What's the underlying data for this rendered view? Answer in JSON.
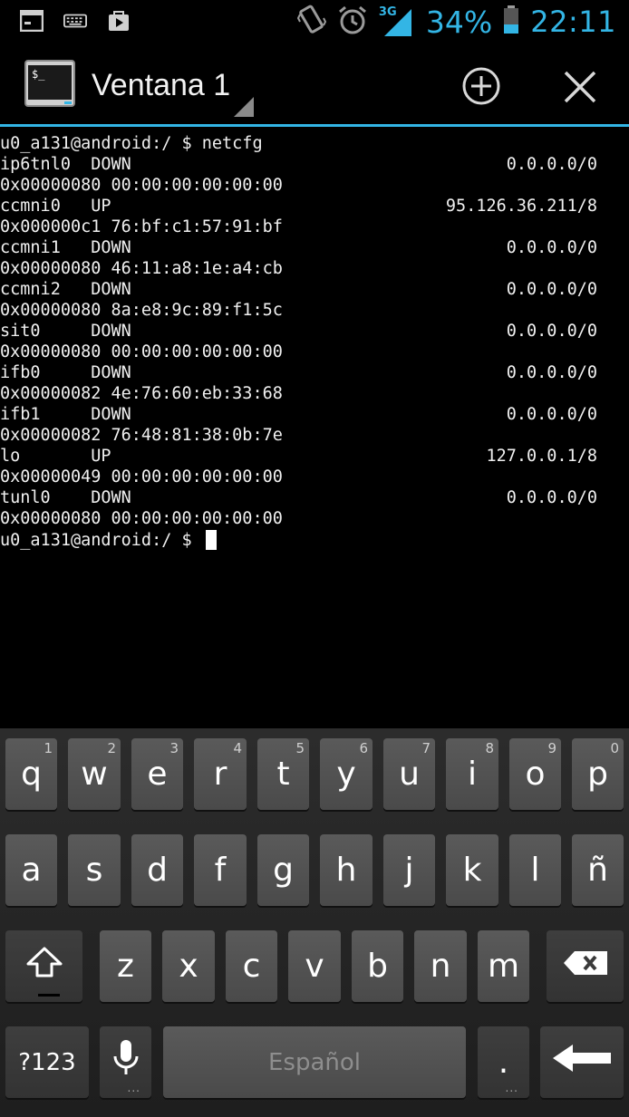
{
  "status_bar": {
    "icons_left": [
      "terminal-notification-icon",
      "keyboard-icon",
      "play-store-icon"
    ],
    "icons_right": [
      "vibrate-icon",
      "alarm-icon",
      "signal-3g-icon",
      "battery-icon"
    ],
    "network": "3G",
    "battery": "34%",
    "time": "22:11",
    "accent_color": "#33b5e5"
  },
  "action_bar": {
    "title": "Ventana 1",
    "add_icon": "add-window-icon",
    "close_icon": "close-window-icon"
  },
  "terminal": {
    "lines": [
      {
        "left": "u0_a131@android:/ $ netcfg",
        "right": ""
      },
      {
        "left": "ip6tnl0  DOWN",
        "right": "0.0.0.0/0"
      },
      {
        "left": "0x00000080 00:00:00:00:00:00",
        "right": ""
      },
      {
        "left": "ccmni0   UP",
        "right": "95.126.36.211/8"
      },
      {
        "left": "0x000000c1 76:bf:c1:57:91:bf",
        "right": ""
      },
      {
        "left": "ccmni1   DOWN",
        "right": "0.0.0.0/0"
      },
      {
        "left": "0x00000080 46:11:a8:1e:a4:cb",
        "right": ""
      },
      {
        "left": "ccmni2   DOWN",
        "right": "0.0.0.0/0"
      },
      {
        "left": "0x00000080 8a:e8:9c:89:f1:5c",
        "right": ""
      },
      {
        "left": "sit0     DOWN",
        "right": "0.0.0.0/0"
      },
      {
        "left": "0x00000080 00:00:00:00:00:00",
        "right": ""
      },
      {
        "left": "ifb0     DOWN",
        "right": "0.0.0.0/0"
      },
      {
        "left": "0x00000082 4e:76:60:eb:33:68",
        "right": ""
      },
      {
        "left": "ifb1     DOWN",
        "right": "0.0.0.0/0"
      },
      {
        "left": "0x00000082 76:48:81:38:0b:7e",
        "right": ""
      },
      {
        "left": "lo       UP",
        "right": "127.0.0.1/8"
      },
      {
        "left": "0x00000049 00:00:00:00:00:00",
        "right": ""
      },
      {
        "left": "tunl0    DOWN",
        "right": "0.0.0.0/0"
      },
      {
        "left": "0x00000080 00:00:00:00:00:00",
        "right": ""
      }
    ],
    "prompt": "u0_a131@android:/ $"
  },
  "keyboard": {
    "row1": [
      {
        "key": "q",
        "hint": "1"
      },
      {
        "key": "w",
        "hint": "2"
      },
      {
        "key": "e",
        "hint": "3"
      },
      {
        "key": "r",
        "hint": "4"
      },
      {
        "key": "t",
        "hint": "5"
      },
      {
        "key": "y",
        "hint": "6"
      },
      {
        "key": "u",
        "hint": "7"
      },
      {
        "key": "i",
        "hint": "8"
      },
      {
        "key": "o",
        "hint": "9"
      },
      {
        "key": "p",
        "hint": "0"
      }
    ],
    "row2": [
      "a",
      "s",
      "d",
      "f",
      "g",
      "h",
      "j",
      "k",
      "l",
      "ñ"
    ],
    "row3": [
      "z",
      "x",
      "c",
      "v",
      "b",
      "n",
      "m"
    ],
    "symbols_label": "?123",
    "space_label": "Español",
    "period_label": ".",
    "shift_icon": "shift-icon",
    "delete_icon": "backspace-icon",
    "enter_icon": "enter-icon",
    "mic_icon": "microphone-icon"
  }
}
